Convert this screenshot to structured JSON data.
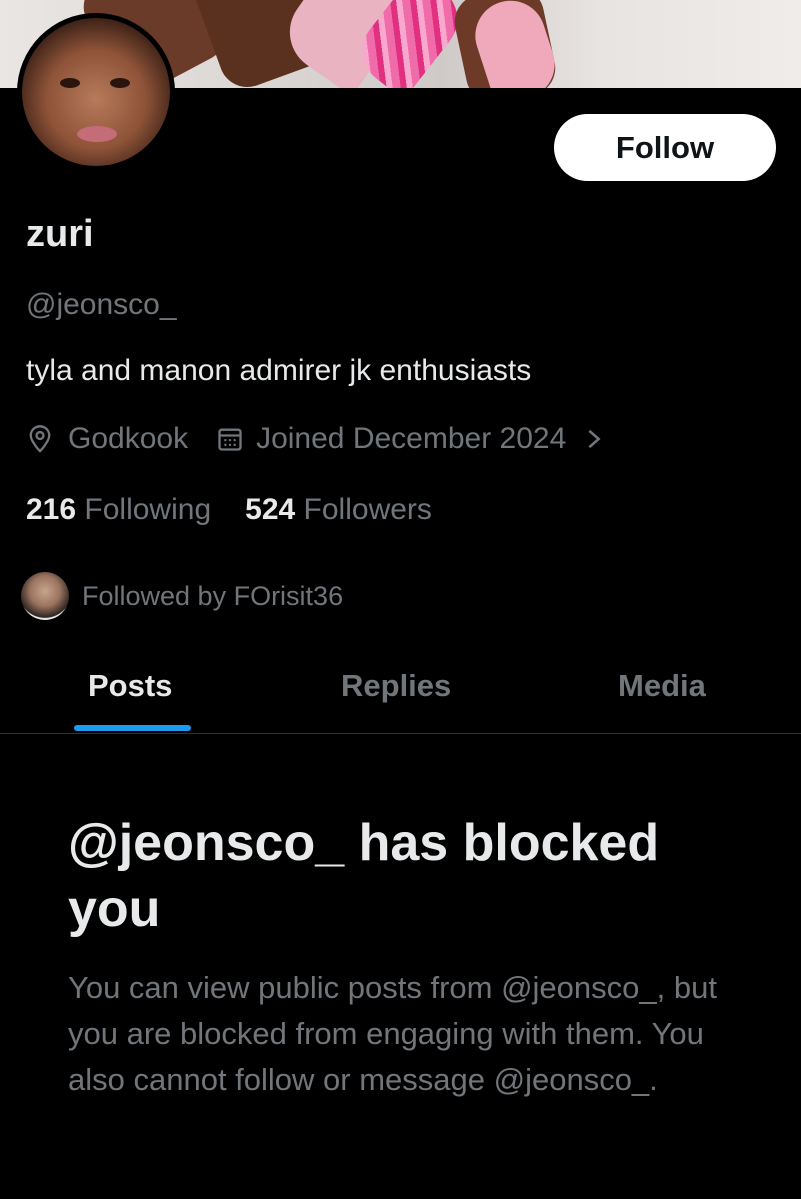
{
  "profile": {
    "name": "zuri",
    "handle": "@jeonsco_",
    "bio": "tyla and manon admirer jk enthusiasts",
    "location": "Godkook",
    "joined": "Joined December 2024",
    "following_count": "216",
    "following_label": "Following",
    "followers_count": "524",
    "followers_label": "Followers",
    "followed_by": "Followed by FOrisit36"
  },
  "actions": {
    "follow_label": "Follow"
  },
  "tabs": [
    {
      "label": "Posts",
      "active": true
    },
    {
      "label": "Replies",
      "active": false
    },
    {
      "label": "Media",
      "active": false
    }
  ],
  "blocked": {
    "title": "@jeonsco_ has blocked you",
    "body": "You can view public posts from @jeonsco_, but you are blocked from engaging with them. You also cannot follow or message @jeonsco_."
  },
  "colors": {
    "background": "#000000",
    "primary_text": "#e7e9ea",
    "secondary_text": "#71767b",
    "accent": "#1d9bf0",
    "divider": "#2f3336"
  },
  "icons": {
    "location": "location-pin-icon",
    "joined": "calendar-icon",
    "chevron": "chevron-right-icon"
  }
}
